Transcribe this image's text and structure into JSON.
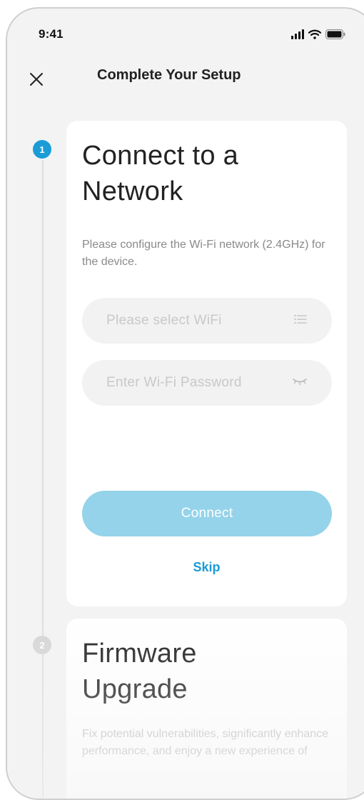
{
  "status_bar": {
    "time": "9:41",
    "icons": [
      "signal-icon",
      "wifi-icon",
      "battery-icon"
    ]
  },
  "header": {
    "close_icon": "close-icon",
    "title": "Complete Your Setup"
  },
  "steps": [
    {
      "number": "1",
      "state": "active",
      "title_line1": "Connect to a",
      "title_line2": "Network",
      "description": "Please configure the Wi-Fi network (2.4GHz) for the device.",
      "wifi_select": {
        "placeholder": "Please select WiFi",
        "icon": "list-icon"
      },
      "wifi_password": {
        "placeholder": "Enter Wi-Fi Password",
        "icon": "eye-closed-icon"
      },
      "connect_label": "Connect",
      "skip_label": "Skip"
    },
    {
      "number": "2",
      "state": "inactive",
      "title_line1": "Firmware",
      "title_line2": "Upgrade",
      "description": "Fix potential vulnerabilities, significantly enhance performance, and enjoy a new experience of"
    }
  ],
  "colors": {
    "accent": "#1a9cd7",
    "button_disabled": "#94d3ea",
    "background": "#f3f3f3",
    "card": "#ffffff",
    "muted_text": "#8a8a8a",
    "placeholder_text": "#c8c8c8"
  }
}
